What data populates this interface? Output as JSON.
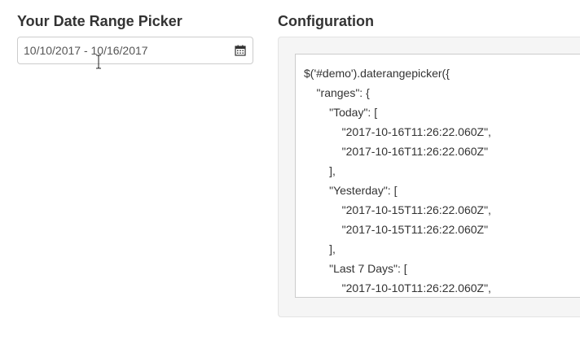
{
  "picker": {
    "heading": "Your Date Range Picker",
    "value": "10/10/2017 - 10/16/2017",
    "icon": "calendar-icon"
  },
  "config": {
    "heading": "Configuration",
    "code_lines": [
      "$('#demo').daterangepicker({",
      "    \"ranges\": {",
      "        \"Today\": [",
      "            \"2017-10-16T11:26:22.060Z\",",
      "            \"2017-10-16T11:26:22.060Z\"",
      "        ],",
      "        \"Yesterday\": [",
      "            \"2017-10-15T11:26:22.060Z\",",
      "            \"2017-10-15T11:26:22.060Z\"",
      "        ],",
      "        \"Last 7 Days\": [",
      "            \"2017-10-10T11:26:22.060Z\","
    ]
  },
  "colors": {
    "text": "#333333",
    "input_text": "#555555",
    "border": "#cccccc",
    "well_bg": "#f5f5f5"
  }
}
